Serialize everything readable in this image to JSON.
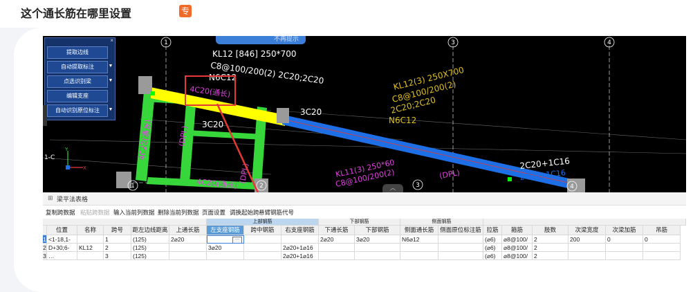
{
  "question": {
    "title": "这个通长筋在哪里设置",
    "badge": "专"
  },
  "cad": {
    "notice": "不再提示",
    "panel": {
      "buttons": [
        "提取边线",
        "自动提取标注",
        "点选识别梁",
        "编辑支座",
        "自动识别原位标注"
      ],
      "close": "×"
    },
    "axes": [
      "1",
      "2",
      "3",
      "4",
      "1",
      "2",
      "3",
      "4"
    ],
    "axis_c_label": "1-C",
    "annotations": {
      "kl12_a": "KL12 [846] 250*700",
      "kl12_b": "C8@100/200(2) 2C20;2C20",
      "kl12_c": "N6C12",
      "highlight": "4C20(通长)",
      "c3_a": "3C20",
      "c3_b": "3C20",
      "kl12_3_a": "KL12(3) 250X700",
      "kl12_3_b": "C8@100/200(2)",
      "kl12_3_c": "2C20;2C20",
      "kl12_3_d": "N6C12",
      "vert_1": "4C22(通长)",
      "vert_2": "(DPL)",
      "bottom_1": "4C20(通长)",
      "vert_3": "(DPL)",
      "kl11_a": "KL11(3) 250*60",
      "kl11_b": "C8@100/200(2)",
      "dpl_right": "(DPL)",
      "right_a": "2C20+1C16",
      "right_b": "2C20+1C16",
      "midtab": "︿"
    }
  },
  "table": {
    "title": "梁平法表格",
    "toolbar": [
      "复制跨数据",
      "粘贴跨数据",
      "输入当前列数据",
      "删除当前列数据",
      "页面设置",
      "调换起始跨",
      "悬臂钢筋代号"
    ],
    "group_headers": [
      "上部钢筋",
      "下部钢筋",
      "侧面钢筋"
    ],
    "headers": [
      "位置",
      "名称",
      "跨号",
      "距左边线距离",
      "上通长筋",
      "左支座钢筋",
      "跨中钢筋",
      "右支座钢筋",
      "下通长筋",
      "下部钢筋",
      "侧面通长筋",
      "侧面原位标注筋",
      "拉筋",
      "箍筋",
      "肢数",
      "次梁宽度",
      "次梁加筋",
      "吊筋"
    ],
    "rows": [
      {
        "num": "1",
        "pos": "<1-18,1-",
        "name": "",
        "span": "1",
        "dist": "(125)",
        "top": "2⌀20",
        "left": "",
        "mid": "",
        "right": "",
        "bottom_cont": "2⌀20",
        "bottom": "3⌀20",
        "side": "N6⌀12",
        "side_orig": "",
        "tie": "(⌀6)",
        "stirrup": "⌀8@100/",
        "legs": "2",
        "sec_w": "200",
        "sec_add": "0",
        "hanger": "0"
      },
      {
        "num": "2",
        "pos": "D+30;6-",
        "name": "KL12",
        "span": "2",
        "dist": "(125)",
        "top": "",
        "left": "3⌀20",
        "mid": "",
        "right": "2⌀20+1⌀16",
        "bottom_cont": "",
        "bottom": "",
        "side": "",
        "side_orig": "",
        "tie": "(⌀6)",
        "stirrup": "⌀8@100/",
        "legs": "2",
        "sec_w": "",
        "sec_add": "",
        "hanger": ""
      },
      {
        "num": "3",
        "pos": "…",
        "name": "",
        "span": "3",
        "dist": "(125)",
        "top": "",
        "left": "",
        "mid": "",
        "right": "2⌀20+1⌀16",
        "bottom_cont": "",
        "bottom": "",
        "side": "",
        "side_orig": "",
        "tie": "(⌀6)",
        "stirrup": "⌀8@100/",
        "legs": "2",
        "sec_w": "",
        "sec_add": "",
        "hanger": ""
      }
    ],
    "edit_button": "···"
  },
  "colors": {
    "beam_yellow": "#ffff00",
    "beam_blue": "#1e6fe6",
    "column_green": "#37d63b",
    "annotation_red": "#e53935",
    "cad_bg": "#000000",
    "accent": "#3b7fd8"
  }
}
